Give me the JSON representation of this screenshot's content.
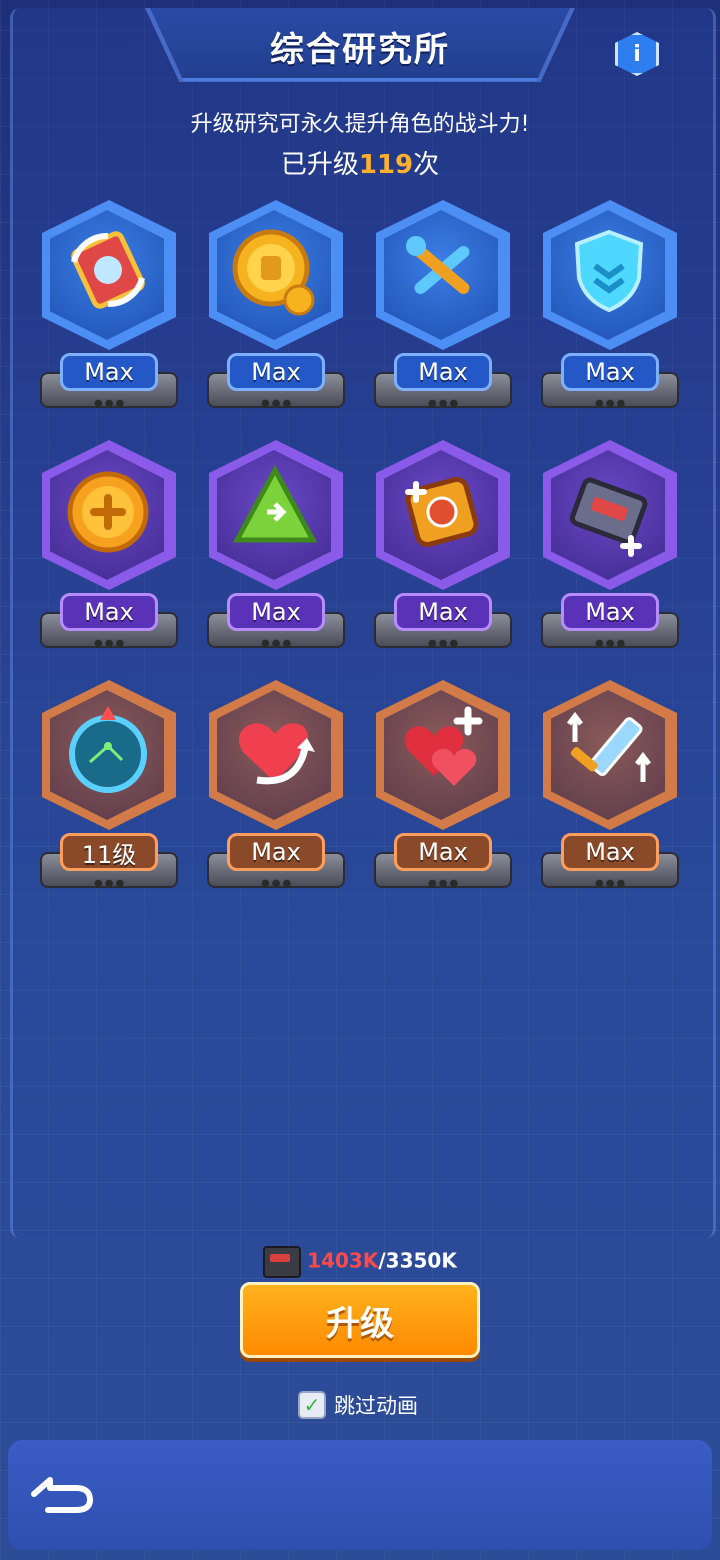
{
  "header": {
    "title": "综合研究所",
    "info_icon": "i"
  },
  "subtitle": "升级研究可永久提升角色的战斗力!",
  "upgrade_count": {
    "prefix": "已升级",
    "value": "119",
    "suffix": "次"
  },
  "research_items": [
    {
      "icon": "card-cycle-icon",
      "tier": "blue",
      "level": "Max"
    },
    {
      "icon": "gold-coin-icon",
      "tier": "blue",
      "level": "Max"
    },
    {
      "icon": "wrench-screwdriver-icon",
      "tier": "blue",
      "level": "Max"
    },
    {
      "icon": "shield-icon",
      "tier": "blue",
      "level": "Max"
    },
    {
      "icon": "plus-coin-icon",
      "tier": "purple",
      "level": "Max"
    },
    {
      "icon": "recycle-icon",
      "tier": "purple",
      "level": "Max"
    },
    {
      "icon": "fuel-canister-icon",
      "tier": "purple",
      "level": "Max"
    },
    {
      "icon": "cassette-plus-icon",
      "tier": "purple",
      "level": "Max"
    },
    {
      "icon": "radar-icon",
      "tier": "orange",
      "level": "11级"
    },
    {
      "icon": "heart-arrow-icon",
      "tier": "orange",
      "level": "Max"
    },
    {
      "icon": "hearts-plus-icon",
      "tier": "orange",
      "level": "Max"
    },
    {
      "icon": "sword-up-icon",
      "tier": "orange",
      "level": "Max"
    }
  ],
  "resource": {
    "icon": "cassette-icon",
    "current": "1403K",
    "separator": "/",
    "max": "3350K"
  },
  "upgrade_button": "升级",
  "skip_animation": {
    "label": "跳过动画",
    "checked": true
  },
  "colors": {
    "accent_orange": "#ff9a10",
    "resource_current": "#ff4a4a",
    "count_highlight": "#ffb02e"
  }
}
